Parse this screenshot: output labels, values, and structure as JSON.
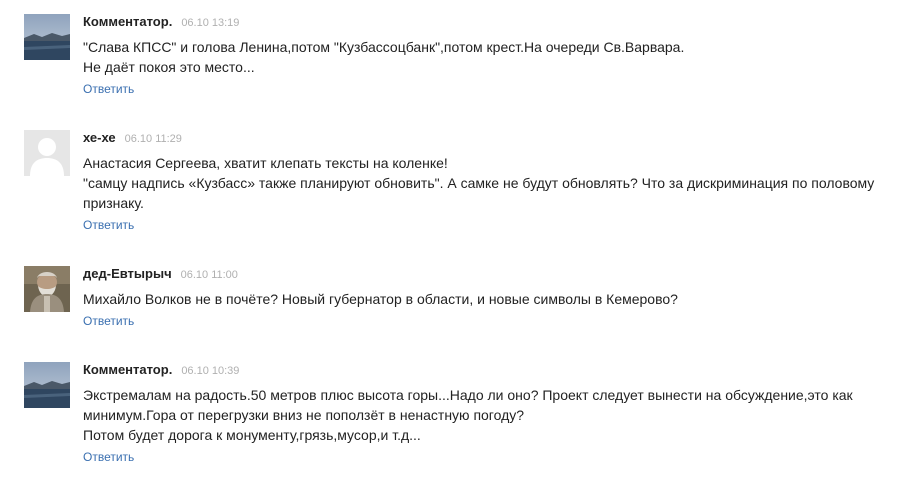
{
  "comments": [
    {
      "author": "Комментатор.",
      "date": "06.10 13:19",
      "avatar_icon": "landscape-photo-avatar",
      "lines": [
        "\"Слава КПСС\" и голова Ленина,потом \"Кузбассоцбанк\",потом крест.На очереди Св.Варвара.",
        "Не даёт покоя это место..."
      ],
      "reply_label": "Ответить"
    },
    {
      "author": "хе-хе",
      "date": "06.10 11:29",
      "avatar_icon": "default-user-avatar",
      "lines": [
        "Анастасия Сергеева, хватит клепать тексты на коленке!",
        "\"самцу надпись «Кузбасс» также планируют обновить\". А самке не будут обновлять? Что за дискриминация по половому",
        "признаку."
      ],
      "reply_label": "Ответить"
    },
    {
      "author": "дед-Евтырыч",
      "date": "06.10 11:00",
      "avatar_icon": "old-man-photo-avatar",
      "lines": [
        "Михайло Волков не в почёте? Новый губернатор в области, и новые символы в Кемерово?"
      ],
      "reply_label": "Ответить"
    },
    {
      "author": "Комментатор.",
      "date": "06.10 10:39",
      "avatar_icon": "landscape-photo-avatar",
      "lines": [
        "Экстремалам на радость.50  метров плюс высота горы...Надо ли оно? Проект следует вынести на обсуждение,это как",
        "минимум.Гора от перегрузки вниз не поползёт в ненастную погоду?",
        "Потом  будет дорога к монументу,грязь,мусор,и т.д..."
      ],
      "reply_label": "Ответить"
    }
  ]
}
